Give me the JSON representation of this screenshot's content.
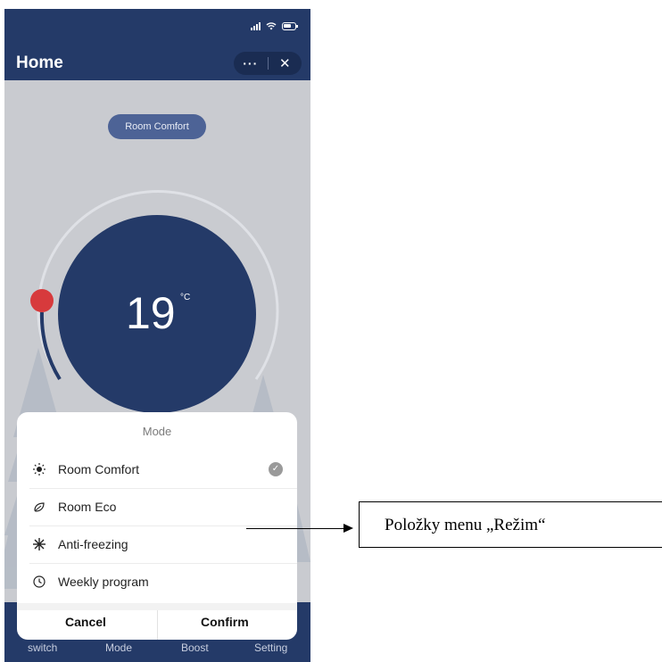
{
  "header": {
    "title": "Home",
    "more_icon": "ellipsis-icon",
    "close_icon": "close-icon",
    "more_label": "···",
    "close_label": "✕"
  },
  "main": {
    "current_mode": "Room Comfort",
    "temperature": "19",
    "unit": "°C",
    "setpoint_fraction": 0.28,
    "colors": {
      "accent": "#243a68",
      "knob": "#d73a3c",
      "pill": "#4d6396"
    }
  },
  "mode_sheet": {
    "title": "Mode",
    "items": [
      {
        "label": "Room Comfort",
        "icon": "sun-icon",
        "selected": true
      },
      {
        "label": "Room Eco",
        "icon": "leaf-icon",
        "selected": false
      },
      {
        "label": "Anti-freezing",
        "icon": "snowflake-icon",
        "selected": false
      },
      {
        "label": "Weekly program",
        "icon": "clock-icon",
        "selected": false
      }
    ],
    "cancel_label": "Cancel",
    "confirm_label": "Confirm"
  },
  "tabbar": {
    "items": [
      "switch",
      "Mode",
      "Boost",
      "Setting"
    ]
  },
  "annotation": {
    "text": "Položky menu „Režim“"
  }
}
